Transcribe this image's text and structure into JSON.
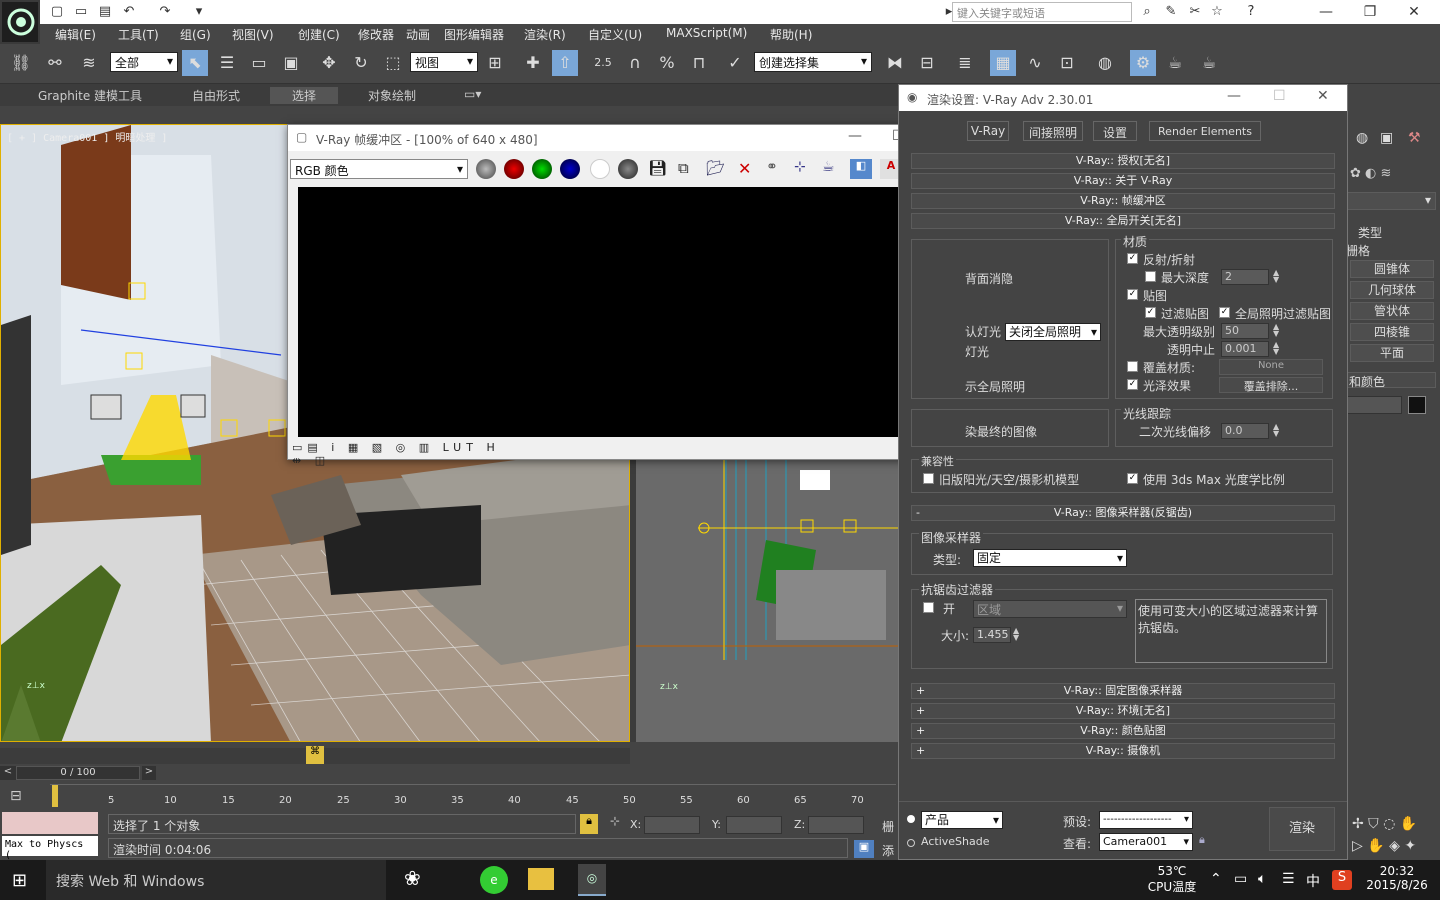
{
  "titlebar": {
    "search_placeholder": "键入关键字或短语",
    "workspace": "",
    "min": "—",
    "max": "❐",
    "close": "✕"
  },
  "menu": [
    "编辑(E)",
    "工具(T)",
    "组(G)",
    "视图(V)",
    "创建(C)",
    "修改器",
    "动画",
    "图形编辑器",
    "渲染(R)",
    "自定义(U)",
    "MAXScript(M)",
    "帮助(H)"
  ],
  "toolbar": {
    "selection_filter": "全部",
    "ref_coord": "视图",
    "named_selection": "创建选择集",
    "snap_value": "2.5"
  },
  "ribbon_tabs": [
    "Graphite 建模工具",
    "自由形式",
    "选择",
    "对象绘制"
  ],
  "viewport": {
    "label": "[ + ] Camera001 ] 明暗处理 ]"
  },
  "vfb": {
    "title": "V-Ray 帧缓冲区 - [100% of 640 x 480]",
    "channel": "RGB 颜色"
  },
  "render_setup": {
    "title": "渲染设置: V-Ray Adv 2.30.01",
    "tabs": [
      "V-Ray",
      "间接照明",
      "设置",
      "Render Elements"
    ],
    "rollouts_top": [
      "V-Ray:: 授权[无名]",
      "V-Ray:: 关于 V-Ray",
      "V-Ray:: 帧缓冲区",
      "V-Ray:: 全局开关[无名]"
    ],
    "materials_group": "材质",
    "reflect_refract": "反射/折射",
    "max_depth": "最大深度",
    "max_depth_val": "2",
    "maps": "贴图",
    "filter_maps": "过滤贴图",
    "gi_filter_maps": "全局照明过滤贴图",
    "max_transp": "最大透明级别",
    "max_transp_val": "50",
    "transp_cutoff": "透明中止",
    "transp_cutoff_val": "0.001",
    "override_mtl": "覆盖材质:",
    "override_none": "None",
    "glossy": "光泽效果",
    "override_excl": "覆盖排除...",
    "backface": "背面消隐",
    "default_lights": "认灯光",
    "default_lights_val": "关闭全局照明",
    "hidden_lights": "灯光",
    "show_gi": "示全局照明",
    "raytrace_group": "光线跟踪",
    "secondary_bias": "二次光线偏移",
    "secondary_bias_val": "0.0",
    "render_final": "染最终的图像",
    "compat": "兼容性",
    "legacy_sun": "旧版阳光/天空/摄影机模型",
    "use_3ds": "使用 3ds Max 光度学比例",
    "sampler_rollout": "V-Ray:: 图像采样器(反锯齿)",
    "sampler_group": "图像采样器",
    "type_label": "类型:",
    "type_val": "固定",
    "aa_group": "抗锯齿过滤器",
    "aa_on": "开",
    "aa_filter": "区域",
    "aa_desc": "使用可变大小的区域过滤器来计算抗锯齿。",
    "size_label": "大小:",
    "size_val": "1.455",
    "rollouts_bottom": [
      "V-Ray:: 固定图像采样器",
      "V-Ray:: 环境[无名]",
      "V-Ray:: 颜色贴图",
      "V-Ray:: 摄像机"
    ],
    "product": "产品",
    "activeshade": "ActiveShade",
    "preset_label": "预设:",
    "preset_val": "-------------------",
    "view_label": "查看:",
    "view_val": "Camera001",
    "render_btn": "渲染"
  },
  "cmd_panel": {
    "type_label": "类型",
    "grid": "栅格",
    "buttons": [
      "圆锥体",
      "几何球体",
      "管状体",
      "四棱锥",
      "平面"
    ],
    "color_label": "和颜色"
  },
  "timeline": {
    "frame": "0 / 100",
    "ticks": [
      "5",
      "10",
      "15",
      "20",
      "25",
      "30",
      "35",
      "40",
      "45",
      "50",
      "55",
      "60",
      "65",
      "70"
    ]
  },
  "status": {
    "script_field": "Max to Physcs (",
    "selected": "选择了 1 个对象",
    "render_time": "渲染时间 0:04:06",
    "x_label": "X:",
    "y_label": "Y:",
    "z_label": "Z:",
    "grid": "栅",
    "add": "添"
  },
  "taskbar": {
    "search": "搜索 Web 和 Windows",
    "temp": "53℃",
    "temp_label": "CPU温度",
    "ime": "中",
    "time": "20:32",
    "date": "2015/8/26"
  }
}
